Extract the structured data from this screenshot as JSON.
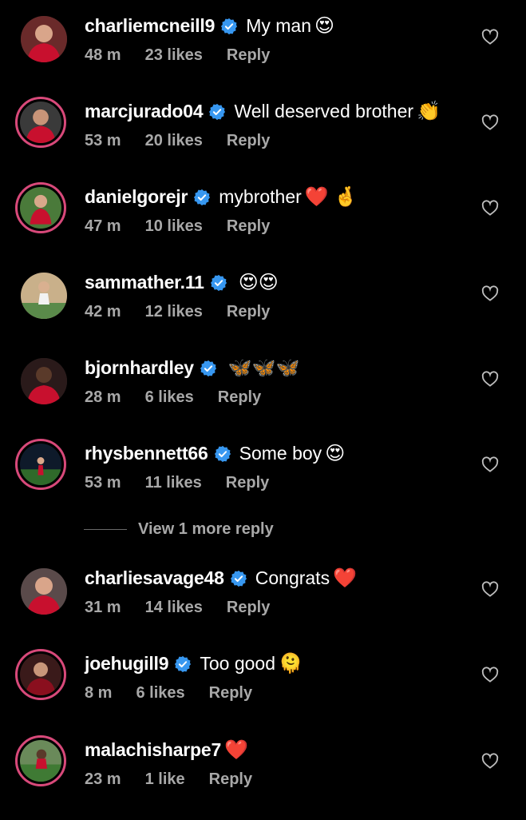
{
  "comments": [
    {
      "user": "charliemcneill9",
      "text": "My man",
      "emoji": "😍",
      "time": "48 m",
      "likes": "23 likes",
      "reply": "Reply"
    },
    {
      "user": "marcjurado04",
      "text": "Well deserved brother",
      "emoji": "👏",
      "time": "53 m",
      "likes": "20 likes",
      "reply": "Reply"
    },
    {
      "user": "danielgorejr",
      "text": "mybrother",
      "emoji": "❤️ 🤞",
      "time": "47 m",
      "likes": "10 likes",
      "reply": "Reply"
    },
    {
      "user": "sammather.11",
      "text": "",
      "emoji": "😍😍",
      "time": "42 m",
      "likes": "12 likes",
      "reply": "Reply"
    },
    {
      "user": "bjornhardley",
      "text": "",
      "emoji": "🦋🦋🦋",
      "time": "28 m",
      "likes": "6 likes",
      "reply": "Reply"
    },
    {
      "user": "rhysbennett66",
      "text": "Some boy",
      "emoji": "😍",
      "time": "53 m",
      "likes": "11 likes",
      "reply": "Reply"
    },
    {
      "user": "charliesavage48",
      "text": "Congrats",
      "emoji": "❤️",
      "time": "31 m",
      "likes": "14 likes",
      "reply": "Reply"
    },
    {
      "user": "joehugill9",
      "text": "Too good",
      "emoji": "🫠",
      "time": "8 m",
      "likes": "6 likes",
      "reply": "Reply"
    },
    {
      "user": "malachisharpe7",
      "text": "",
      "emoji": "❤️",
      "time": "23 m",
      "likes": "1 like",
      "reply": "Reply"
    }
  ],
  "view_more_replies": "View 1 more reply",
  "colors": {
    "verified": "#3797f0",
    "ring": "#d8497a",
    "secondary_text": "#a8a8a8"
  },
  "icons": {
    "verified": "verified-badge-icon",
    "heart": "heart-outline-icon"
  }
}
